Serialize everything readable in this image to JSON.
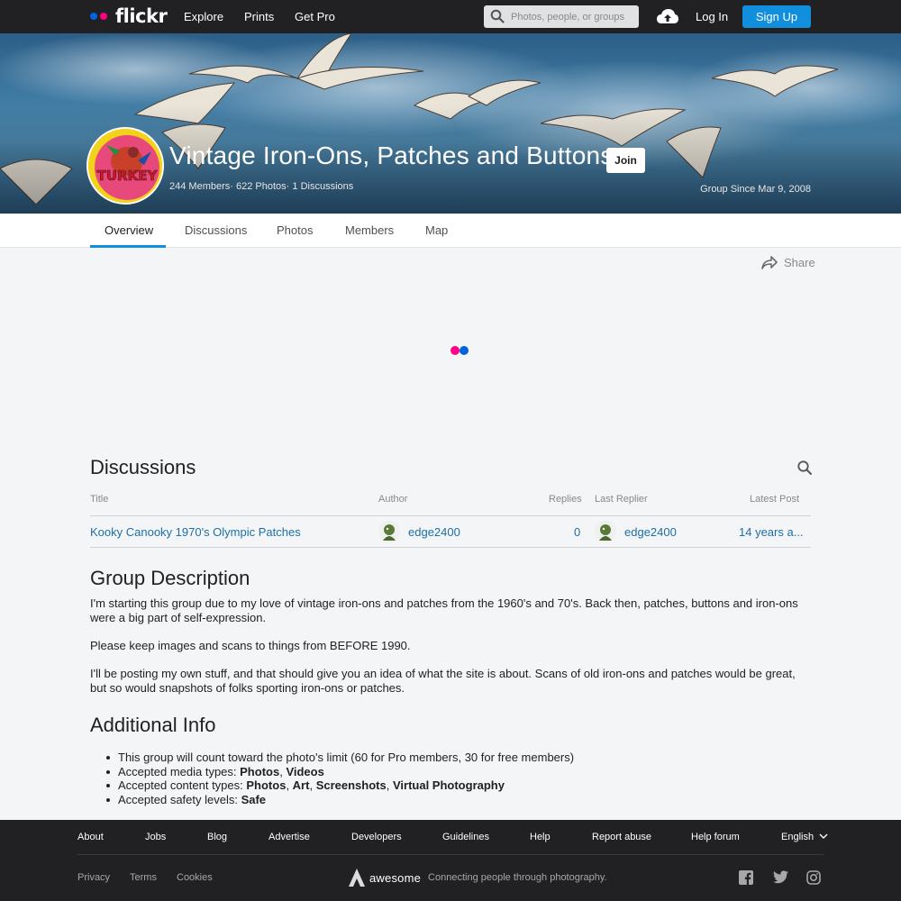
{
  "nav": {
    "logo_text": "flickr",
    "links": [
      "Explore",
      "Prints",
      "Get Pro"
    ],
    "search_placeholder": "Photos, people, or groups",
    "login": "Log In",
    "signup": "Sign Up",
    "colors": {
      "bar": "#212124",
      "dot_blue": "#0063dc",
      "dot_pink": "#ff0084",
      "signup": "#128fdc"
    }
  },
  "group": {
    "title": "Vintage Iron-Ons, Patches and Buttons",
    "members": "244 Members",
    "photos": "622 Photos",
    "discussions": "1 Discussions",
    "join": "Join",
    "since": "Group Since Mar 9, 2008",
    "avatar_text": "TURKEY"
  },
  "tabs": [
    "Overview",
    "Discussions",
    "Photos",
    "Members",
    "Map"
  ],
  "share": "Share",
  "discussions": {
    "title": "Discussions",
    "headers": {
      "title": "Title",
      "author": "Author",
      "replies": "Replies",
      "last_replier": "Last Replier",
      "latest_post": "Latest Post"
    },
    "rows": [
      {
        "title": "Kooky Canooky 1970's Olympic Patches",
        "author": "edge2400",
        "replies": "0",
        "last_replier": "edge2400",
        "latest_post": "14 years a..."
      }
    ]
  },
  "description": {
    "title": "Group Description",
    "paragraphs": [
      "I'm starting this group due to my love of vintage iron-ons and patches from the 1960's and 70's. Back then, patches, buttons and iron-ons were a big part of self-expression.",
      "Please keep images and scans to things from BEFORE 1990.",
      "I'll be posting my own stuff, and that should give you an idea of what the site is about. Scans of old iron-ons and patches would be great, but so would snapshots of folks sporting iron-ons or patches."
    ]
  },
  "additional": {
    "title": "Additional Info",
    "items": [
      {
        "label": "This group will count toward the photo's limit (60 for Pro members, 30 for free members)"
      },
      {
        "label": "Accepted media types: ",
        "values": [
          "Photos",
          "Videos"
        ]
      },
      {
        "label": "Accepted content types: ",
        "values": [
          "Photos",
          "Art",
          "Screenshots",
          "Virtual Photography"
        ]
      },
      {
        "label": "Accepted safety levels: ",
        "values": [
          "Safe"
        ]
      }
    ]
  },
  "footer": {
    "links": [
      "About",
      "Jobs",
      "Blog",
      "Advertise",
      "Developers",
      "Guidelines",
      "Help",
      "Report abuse",
      "Help forum",
      "English"
    ],
    "legal": [
      "Privacy",
      "Terms",
      "Cookies"
    ],
    "brand": "awesome",
    "tagline": "Connecting people through photography."
  }
}
